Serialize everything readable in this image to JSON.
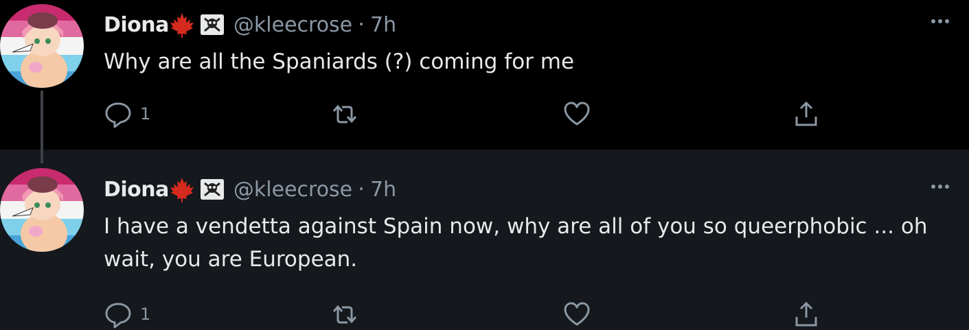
{
  "tweets": [
    {
      "display_name": "Diona",
      "handle": "@kleecrose",
      "separator": "·",
      "time": "7h",
      "text": "Why are all the Spaniards (?) coming for me",
      "reply_count": "1"
    },
    {
      "display_name": "Diona",
      "handle": "@kleecrose",
      "separator": "·",
      "time": "7h",
      "text": "I have a vendetta against Spain now, why are all of you so queerphobic ... oh\nwait, you are European.",
      "reply_count": "1"
    }
  ],
  "icons": {
    "flag": "canada-flag-icon",
    "badge": "skull-crossbones-icon",
    "more": "more-options-icon",
    "reply": "reply-icon",
    "retweet": "retweet-icon",
    "like": "heart-icon",
    "share": "share-icon"
  },
  "colors": {
    "background": "#000000",
    "reply_background": "#15181c",
    "text": "#e7e9ea",
    "muted": "#8b98a5",
    "flag_red": "#d52b1e"
  }
}
